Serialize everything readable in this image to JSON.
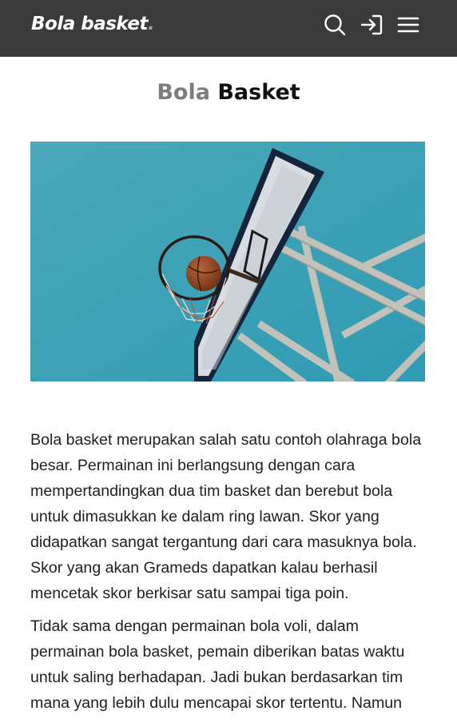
{
  "header": {
    "logo_text": "Bola basket",
    "logo_dot": ".",
    "icons": [
      "search-icon",
      "login-icon",
      "menu-icon"
    ]
  },
  "page": {
    "title_part1": "Bola",
    "title_part2": "Basket"
  },
  "hero": {
    "image": "basketball-hoop-photo",
    "sky_color": "#3fa3b8"
  },
  "article": {
    "paragraphs": [
      "Bola basket merupakan salah satu contoh olahraga bola besar. Permainan ini berlangsung dengan cara mempertandingkan dua tim basket dan berebut bola untuk dimasukkan ke dalam ring lawan. Skor yang didapatkan sangat tergantung dari cara masuknya bola. Skor yang akan Grameds dapatkan kalau berhasil mencetak skor berkisar satu sampai tiga poin.",
      "Tidak sama dengan permainan bola voli, dalam permainan bola basket, pemain diberikan batas waktu untuk saling berhadapan. Jadi bukan berdasarkan tim mana yang lebih dulu mencapai skor tertentu. Namun"
    ]
  },
  "colors": {
    "header_bg": "#3a3a3a",
    "title_muted": "#7d7d7d",
    "text": "#1f1f1f"
  }
}
